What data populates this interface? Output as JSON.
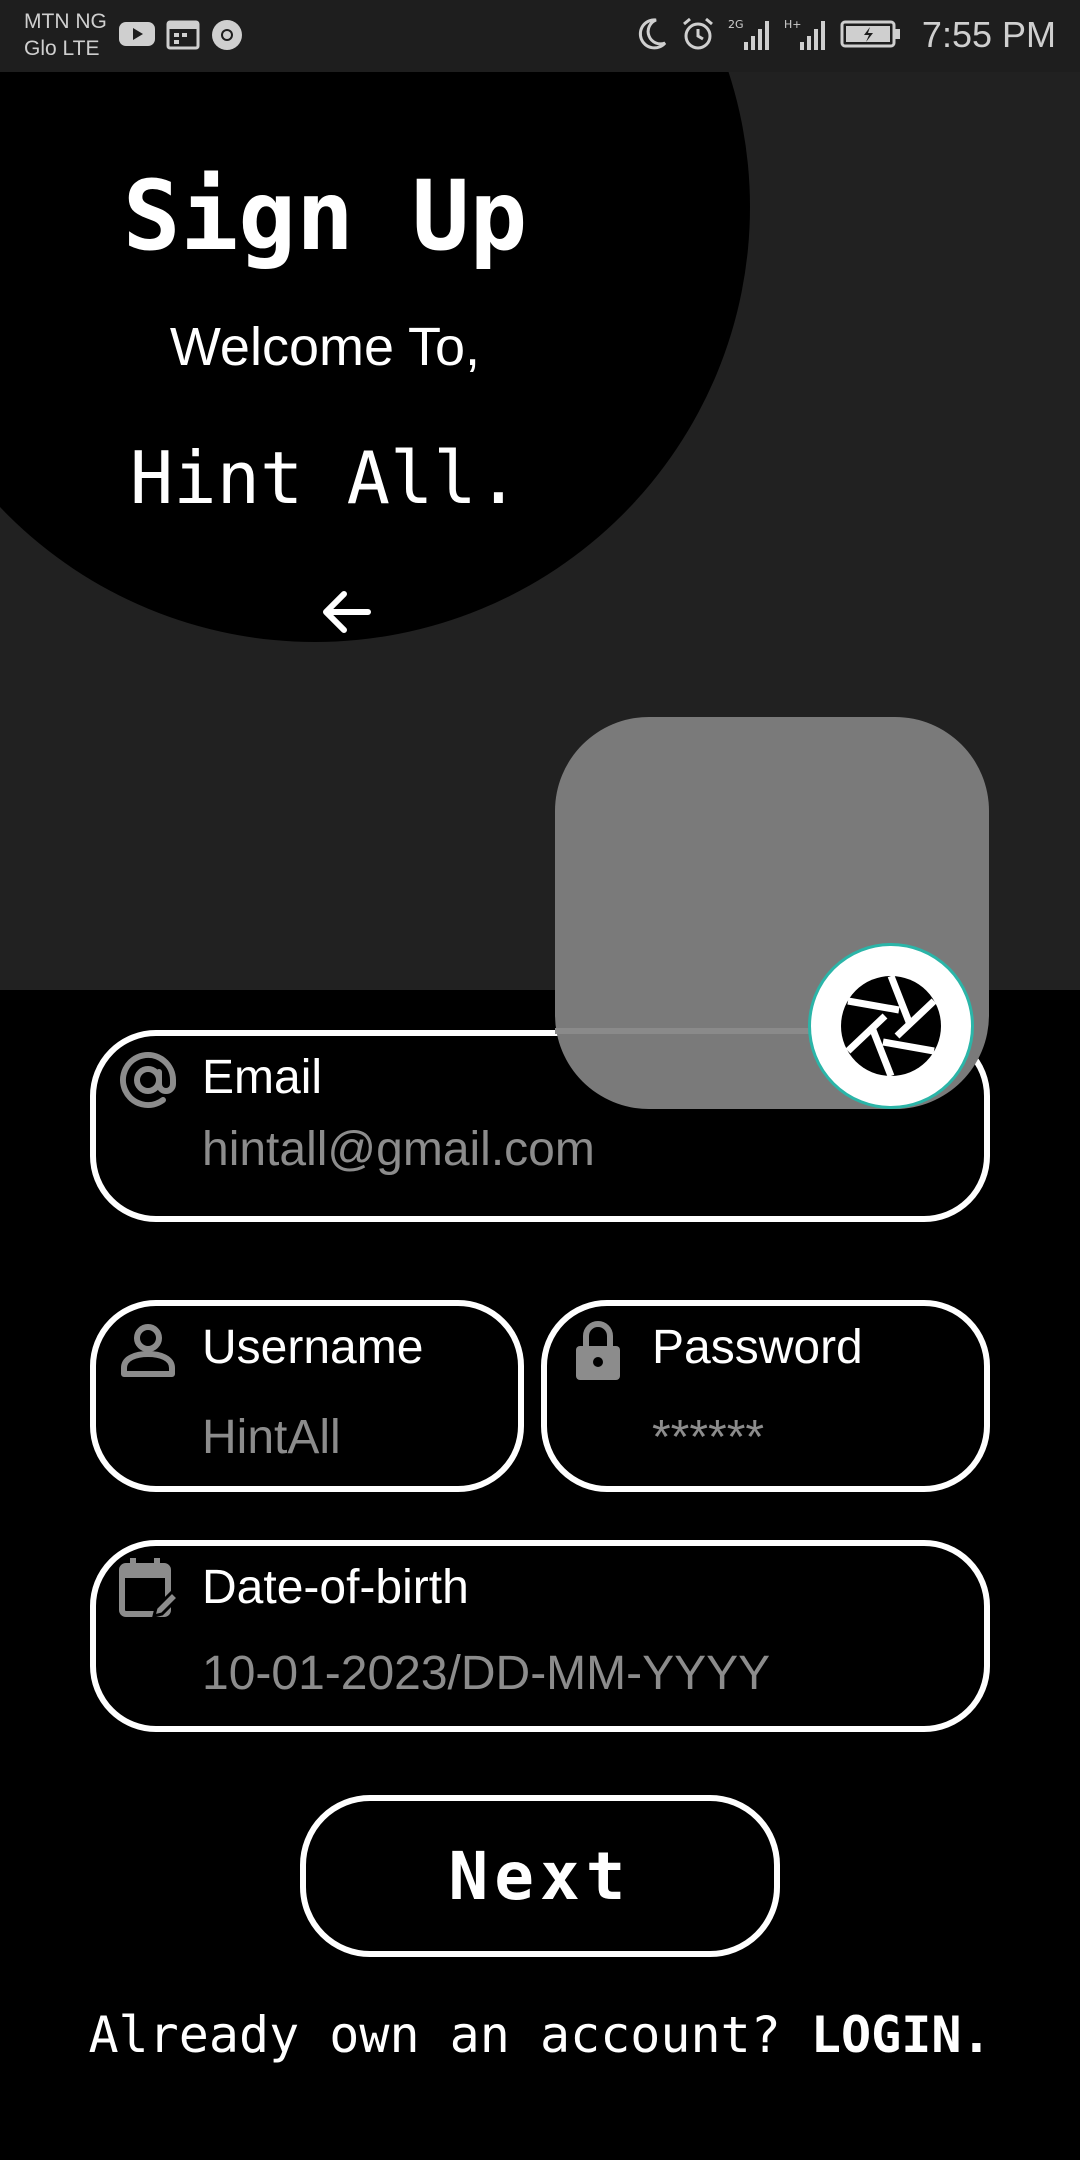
{
  "status_bar": {
    "carrier_line1": "MTN NG",
    "carrier_line2": "Glo LTE",
    "left_icons": [
      "youtube-icon",
      "calendar-icon",
      "chrome-icon"
    ],
    "right_icons": [
      "moon-icon",
      "alarm-icon",
      "signal-2g-icon",
      "signal-h-icon",
      "battery-charging-icon"
    ],
    "time": "7:55 PM"
  },
  "header": {
    "title": "Sign Up",
    "welcome": "Welcome To,",
    "app_name": "Hint All."
  },
  "form": {
    "email": {
      "label": "Email",
      "value": "hintall@gmail.com"
    },
    "username": {
      "label": "Username",
      "value": "HintAll"
    },
    "password": {
      "label": "Password",
      "value": "******"
    },
    "dob": {
      "label": "Date-of-birth",
      "value": "10-01-2023/DD-MM-YYYY"
    }
  },
  "actions": {
    "next_label": "Next",
    "footer_text": "Already own an account?",
    "login_label": "LOGIN."
  },
  "colors": {
    "background": "#000000",
    "panel": "#212121",
    "photo_box": "#7a7a7a",
    "camera_ring": "#2bb5a8",
    "placeholder": "#8c8c8c"
  }
}
